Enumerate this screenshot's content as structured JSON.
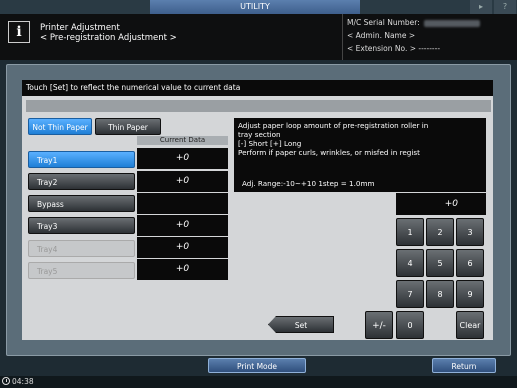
{
  "topbar": {
    "tab_label": "UTILITY",
    "volume_icon": "volume-icon",
    "help_icon": "help-icon",
    "help_label": "?"
  },
  "header": {
    "info_icon_label": "i",
    "title_line1": "Printer Adjustment",
    "title_line2": "< Pre-registration Adjustment >",
    "serial_label": "M/C Serial Number:",
    "admin_label": "< Admin. Name >",
    "extension_label": "< Extension No. >",
    "extension_value": "--------"
  },
  "message": "Touch [Set] to reflect the numerical value to current data",
  "paper_tabs": {
    "active": "Not Thin Paper",
    "inactive": "Thin Paper"
  },
  "current_data_header": "Current Data",
  "trays": [
    {
      "label": "Tray1",
      "value": "+0",
      "state": "selected"
    },
    {
      "label": "Tray2",
      "value": "+0",
      "state": "normal"
    },
    {
      "label": "Bypass",
      "value": "",
      "state": "normal"
    },
    {
      "label": "Tray3",
      "value": "+0",
      "state": "normal"
    },
    {
      "label": "Tray4",
      "value": "+0",
      "state": "disabled"
    },
    {
      "label": "Tray5",
      "value": "+0",
      "state": "disabled"
    }
  ],
  "description": {
    "line1": "Adjust paper loop amount of pre-registration roller in",
    "line2": "tray section",
    "line3": "[-] Short [+] Long",
    "line4": "Perform if paper curls, wrinkles, or misfed in regist",
    "range": "Adj. Range:-10~+10 1step = 1.0mm"
  },
  "input_display": "+0",
  "keypad": {
    "k1": "1",
    "k2": "2",
    "k3": "3",
    "k4": "4",
    "k5": "5",
    "k6": "6",
    "k7": "7",
    "k8": "8",
    "k9": "9",
    "k0": "0",
    "plus_minus": "+/-",
    "clear": "Clear"
  },
  "set_label": "Set",
  "print_mode_label": "Print Mode",
  "return_label": "Return",
  "clock": "04:38"
}
